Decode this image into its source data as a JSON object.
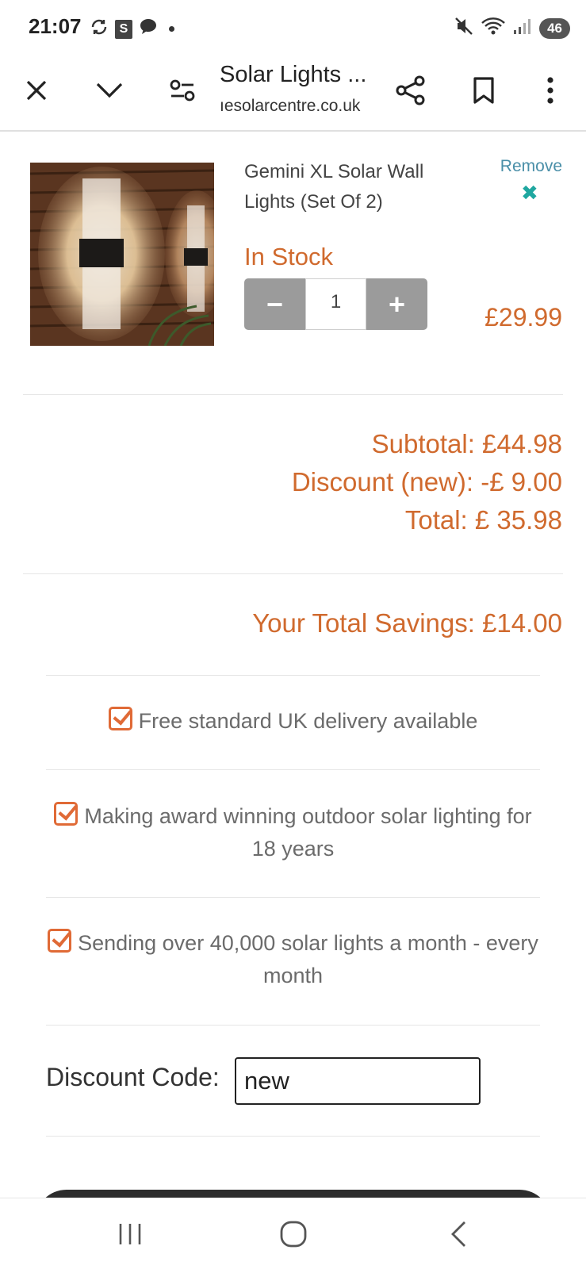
{
  "status_bar": {
    "time": "21:07",
    "s_badge": "S",
    "battery": "46",
    "icons": [
      "sync-icon",
      "messages-icon",
      "mute-icon",
      "wifi-icon",
      "signal-icon"
    ]
  },
  "browser": {
    "title": "Solar Lights ...",
    "url": "ıesolarcentre.co.uk"
  },
  "product": {
    "name": "Gemini XL Solar Wall Lights (Set Of 2)",
    "remove_label": "Remove",
    "remove_icon": "✖",
    "stock": "In Stock",
    "quantity": "1",
    "minus_label": "−",
    "plus_label": "+",
    "price": "£29.99"
  },
  "summary": {
    "subtotal": "Subtotal:  £44.98",
    "discount": "Discount (new): -£ 9.00",
    "total": "Total:  £ 35.98",
    "savings": "Your Total Savings:  £14.00"
  },
  "benefits": [
    "Free standard UK delivery available",
    "Making award winning outdoor solar lighting for 18 years",
    "Sending over 40,000 solar lights a month - every month"
  ],
  "discount_code": {
    "label": "Discount Code:",
    "value": "new"
  },
  "colors": {
    "accent": "#d06a2e",
    "link": "#4a8fa8",
    "remove_x": "#1fa7a0",
    "qty_button": "#9b9b9b"
  }
}
